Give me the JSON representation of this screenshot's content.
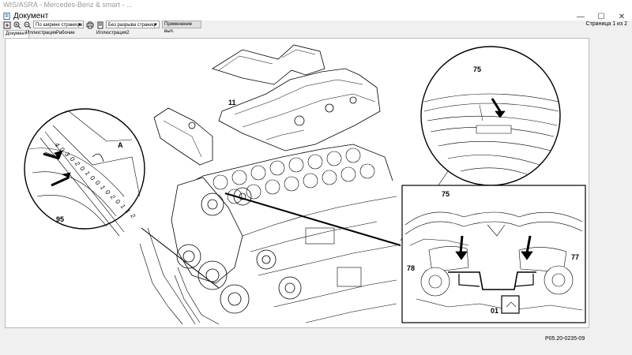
{
  "window": {
    "top_title": "WIS/ASRA - Mercedes-Benz & smart - ...",
    "doc_title": "Документ",
    "controls": [
      "—",
      "☐",
      "✕"
    ]
  },
  "toolbar": {
    "zoom_mode": "По ширине страницы",
    "view_mode": "Без разрыва страниц",
    "apply_button": "Применение вып.",
    "page_info": "Страница 1 из 2"
  },
  "tabs": [
    "Документ",
    "Иллюстрация",
    "Рабочие операции",
    "Иллюстрация2"
  ],
  "figure": {
    "labels": {
      "cover": "11",
      "ring_mark": "A",
      "sensor": "95",
      "tool_top": "75",
      "tool_bottom": "75",
      "left_shaft": "78",
      "right_shaft": "77",
      "bracket": "01"
    },
    "caption": "P05.20-0235-09",
    "scale_marks": [
      "4",
      "0",
      "3",
      "0",
      "2",
      "0",
      "1",
      "0",
      "0",
      "1",
      "0",
      "2",
      "0",
      "1",
      "1",
      "2"
    ]
  },
  "icons": [
    "document-icon",
    "zoom-fit-icon",
    "zoom-in-icon",
    "zoom-out-icon",
    "print-icon",
    "page-icon"
  ]
}
